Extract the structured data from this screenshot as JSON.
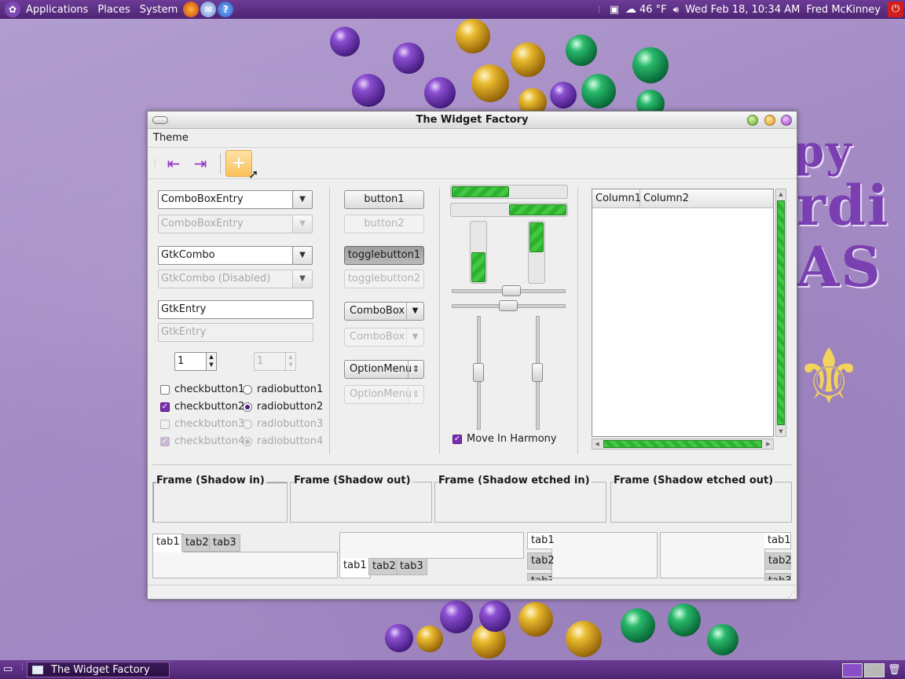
{
  "top_panel": {
    "menus": [
      "Applications",
      "Places",
      "System"
    ],
    "weather": "46 °F",
    "datetime": "Wed Feb 18, 10:34 AM",
    "user": "Fred McKinney"
  },
  "window": {
    "title": "The Widget Factory",
    "menu": [
      "Theme"
    ],
    "toolbar": {
      "icons": [
        "go-first-icon",
        "go-last-icon",
        "add-icon"
      ]
    },
    "col1": {
      "combo_entry_1": "ComboBoxEntry",
      "combo_entry_2": "ComboBoxEntry",
      "gtk_combo_1": "GtkCombo",
      "gtk_combo_2": "GtkCombo (Disabled)",
      "entry_1": "GtkEntry",
      "entry_2": "GtkEntry",
      "spin_1": "1",
      "spin_2": "1",
      "checks": [
        {
          "label": "checkbutton1",
          "checked": false,
          "disabled": false
        },
        {
          "label": "checkbutton2",
          "checked": true,
          "disabled": false
        },
        {
          "label": "checkbutton3",
          "checked": false,
          "disabled": true
        },
        {
          "label": "checkbutton4",
          "checked": true,
          "disabled": true
        }
      ],
      "radios": [
        {
          "label": "radiobutton1",
          "checked": false,
          "disabled": false
        },
        {
          "label": "radiobutton2",
          "checked": true,
          "disabled": false
        },
        {
          "label": "radiobutton3",
          "checked": false,
          "disabled": true
        },
        {
          "label": "radiobutton4",
          "checked": true,
          "disabled": true
        }
      ]
    },
    "col2": {
      "button1": "button1",
      "button2": "button2",
      "toggle1": "togglebutton1",
      "toggle2": "togglebutton2",
      "combobox1": "ComboBox",
      "combobox2": "ComboBox",
      "optionmenu1": "OptionMenu",
      "optionmenu2": "OptionMenu"
    },
    "col3": {
      "hprogress_1": 0.5,
      "hprogress_2": 0.5,
      "vprogress_1": 0.5,
      "vprogress_2": 0.5,
      "move_in_harmony": "Move In Harmony"
    },
    "tree": {
      "column1": "Column1",
      "column2": "Column2"
    },
    "frames": [
      "Frame (Shadow in)",
      "Frame (Shadow out)",
      "Frame (Shadow etched in)",
      "Frame (Shadow etched out)"
    ],
    "tabs": [
      "tab1",
      "tab2",
      "tab3"
    ]
  },
  "bottom_panel": {
    "task": "The Widget Factory"
  },
  "colors": {
    "panel": "#5c2e84",
    "accent": "#7b2fb0",
    "progress": "#35b935"
  }
}
